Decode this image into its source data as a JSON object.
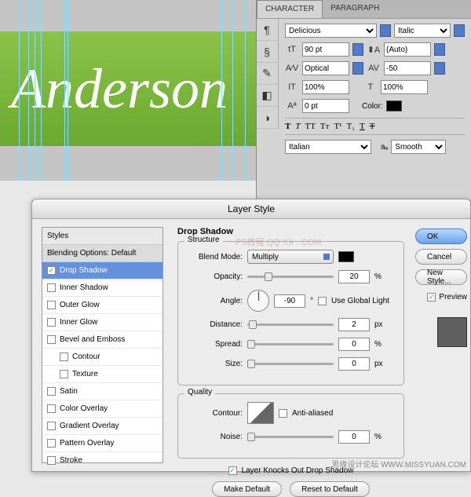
{
  "canvas": {
    "text": "Anderson",
    "guide_positions": [
      24,
      36,
      44,
      52,
      82,
      86,
      282,
      296,
      312
    ]
  },
  "char_panel": {
    "tabs": {
      "character": "CHARACTER",
      "paragraph": "PARAGRAPH"
    },
    "font_family": "Delicious",
    "font_style": "Italic",
    "size": "90 pt",
    "leading": "(Auto)",
    "kerning": "Optical",
    "tracking": "-50",
    "vscale": "100%",
    "hscale": "100%",
    "baseline": "0 pt",
    "color_label": "Color:",
    "language": "Italian",
    "aa_label": "Smooth"
  },
  "layer_style": {
    "title": "Layer Style",
    "styles_header": "Styles",
    "blending_default": "Blending Options: Default",
    "items": [
      {
        "k": "drop_shadow",
        "label": "Drop Shadow",
        "checked": true,
        "selected": true
      },
      {
        "k": "inner_shadow",
        "label": "Inner Shadow"
      },
      {
        "k": "outer_glow",
        "label": "Outer Glow"
      },
      {
        "k": "inner_glow",
        "label": "Inner Glow"
      },
      {
        "k": "bevel",
        "label": "Bevel and Emboss"
      },
      {
        "k": "contour",
        "label": "Contour",
        "indent": true
      },
      {
        "k": "texture",
        "label": "Texture",
        "indent": true
      },
      {
        "k": "satin",
        "label": "Satin"
      },
      {
        "k": "color_overlay",
        "label": "Color Overlay"
      },
      {
        "k": "gradient_overlay",
        "label": "Gradient Overlay"
      },
      {
        "k": "pattern_overlay",
        "label": "Pattern Overlay"
      },
      {
        "k": "stroke",
        "label": "Stroke"
      }
    ],
    "section": "Drop Shadow",
    "structure": "Structure",
    "blend_mode_label": "Blend Mode:",
    "blend_mode": "Multiply",
    "opacity_label": "Opacity:",
    "opacity": "20",
    "angle_label": "Angle:",
    "angle": "-90",
    "use_global": "Use Global Light",
    "distance_label": "Distance:",
    "distance": "2",
    "spread_label": "Spread:",
    "spread": "0",
    "size_label": "Size:",
    "size": "0",
    "pct": "%",
    "px": "px",
    "deg": "°",
    "quality": "Quality",
    "contour_label": "Contour:",
    "anti_aliased": "Anti-aliased",
    "noise_label": "Noise:",
    "noise": "0",
    "knockout": "Layer Knocks Out Drop Shadow",
    "make_default": "Make Default",
    "reset_default": "Reset to Default",
    "buttons": {
      "ok": "OK",
      "cancel": "Cancel",
      "new_style": "New Style...",
      "preview": "Preview"
    }
  },
  "watermark": "思缘设计论坛   WWW.MISSYUAN.COM",
  "wm_center": "PS教程 QQ   XX . COM"
}
